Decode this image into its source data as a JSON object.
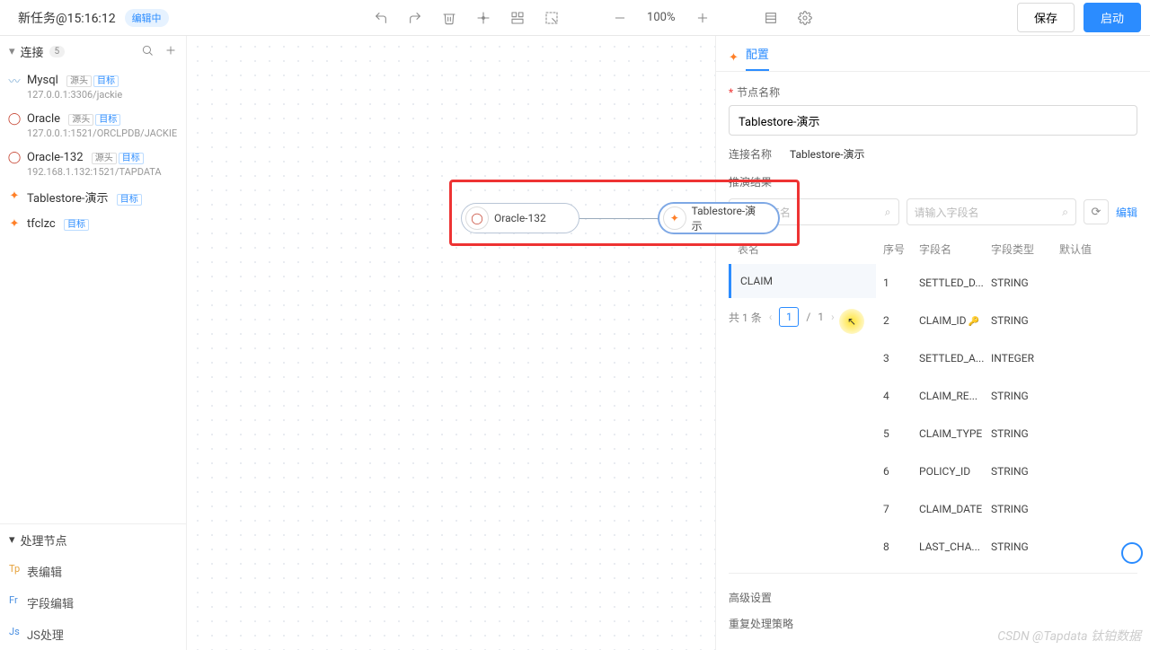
{
  "topbar": {
    "task_title": "新任务@15:16:12",
    "edit_badge": "编辑中",
    "zoom": "100%",
    "save_label": "保存",
    "start_label": "启动"
  },
  "left": {
    "section_conn": "连接",
    "conn_count": "5",
    "section_proc": "处理节点",
    "connections": [
      {
        "name": "Mysql",
        "addr": "127.0.0.1:3306/jackie",
        "tags": [
          "源头",
          "目标"
        ],
        "icon": "mysql",
        "color": "#8ab4d8"
      },
      {
        "name": "Oracle",
        "addr": "127.0.0.1:1521/ORCLPDB/JACKIE",
        "tags": [
          "源头",
          "目标"
        ],
        "icon": "oracle",
        "color": "#c74634"
      },
      {
        "name": "Oracle-132",
        "addr": "192.168.1.132:1521/TAPDATA",
        "tags": [
          "源头",
          "目标"
        ],
        "icon": "oracle",
        "color": "#c74634"
      },
      {
        "name": "Tablestore-演示",
        "addr": "",
        "tags": [
          "目标"
        ],
        "icon": "tablestore",
        "color": "#ff7f27"
      },
      {
        "name": "tfclzc",
        "addr": "",
        "tags": [
          "目标"
        ],
        "icon": "tablestore",
        "color": "#ff7f27"
      }
    ],
    "proc_nodes": [
      {
        "label": "表编辑",
        "abbr": "Tp",
        "color": "#e6a23c"
      },
      {
        "label": "字段编辑",
        "abbr": "Fr",
        "color": "#4a90e2"
      },
      {
        "label": "JS处理",
        "abbr": "Js",
        "color": "#4a90e2"
      }
    ]
  },
  "canvas": {
    "node1": "Oracle-132",
    "node2": "Tablestore-演示"
  },
  "right": {
    "tab_label": "配置",
    "node_name_label": "节点名称",
    "node_name_value": "Tablestore-演示",
    "conn_name_label": "连接名称",
    "conn_name_value": "Tablestore-演示",
    "deduce_label": "推演结果",
    "search_table_placeholder": "请输入表名",
    "search_field_placeholder": "请输入字段名",
    "edit_link": "编辑",
    "table_header": "表名",
    "tables": [
      "CLAIM"
    ],
    "field_headers": {
      "idx": "序号",
      "name": "字段名",
      "type": "字段类型",
      "default": "默认值"
    },
    "fields": [
      {
        "idx": "1",
        "name": "SETTLED_D...",
        "type": "STRING",
        "default": "",
        "key": false
      },
      {
        "idx": "2",
        "name": "CLAIM_ID",
        "type": "STRING",
        "default": "",
        "key": true
      },
      {
        "idx": "3",
        "name": "SETTLED_A...",
        "type": "INTEGER",
        "default": "",
        "key": false
      },
      {
        "idx": "4",
        "name": "CLAIM_RE...",
        "type": "STRING",
        "default": "",
        "key": false
      },
      {
        "idx": "5",
        "name": "CLAIM_TYPE",
        "type": "STRING",
        "default": "",
        "key": false
      },
      {
        "idx": "6",
        "name": "POLICY_ID",
        "type": "STRING",
        "default": "",
        "key": false
      },
      {
        "idx": "7",
        "name": "CLAIM_DATE",
        "type": "STRING",
        "default": "",
        "key": false
      },
      {
        "idx": "8",
        "name": "LAST_CHA...",
        "type": "STRING",
        "default": "",
        "key": false
      }
    ],
    "pager_total": "共 1 条",
    "pager_cur": "1",
    "pager_sep": "/",
    "pager_pages": "1",
    "adv_settings": "高级设置",
    "dup_strategy": "重复处理策略"
  },
  "watermark": "CSDN @Tapdata 钛铂数据"
}
